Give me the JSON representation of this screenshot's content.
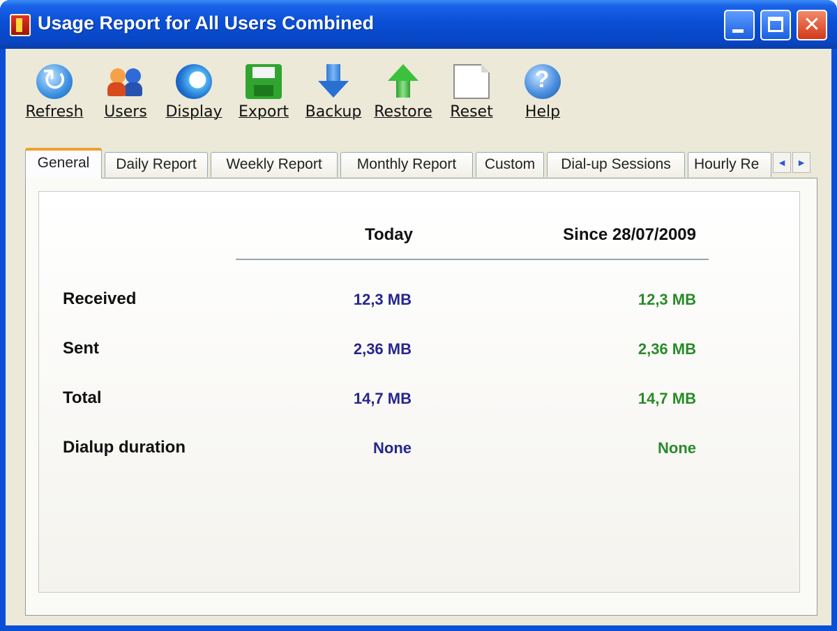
{
  "window": {
    "title": "Usage Report for All Users Combined",
    "controls": {
      "minimize_icon": "minimize-icon",
      "maximize_icon": "maximize-icon",
      "close_glyph": "✕"
    }
  },
  "toolbar": {
    "items": [
      {
        "label": "Refresh",
        "icon": "refresh-icon"
      },
      {
        "label": "Users",
        "icon": "users-icon"
      },
      {
        "label": "Display",
        "icon": "display-icon"
      },
      {
        "label": "Export",
        "icon": "save-icon"
      },
      {
        "label": "Backup",
        "icon": "arrow-down-icon"
      },
      {
        "label": "Restore",
        "icon": "arrow-up-icon"
      },
      {
        "label": "Reset",
        "icon": "blank-page-icon"
      },
      {
        "label": "Help",
        "icon": "help-icon"
      }
    ]
  },
  "tabs": {
    "items": [
      {
        "label": "General",
        "active": true
      },
      {
        "label": "Daily Report"
      },
      {
        "label": "Weekly Report"
      },
      {
        "label": "Monthly Report"
      },
      {
        "label": "Custom"
      },
      {
        "label": "Dial-up Sessions"
      },
      {
        "label": "Hourly Re"
      }
    ],
    "scroll_left": "◄",
    "scroll_right": "►"
  },
  "general": {
    "headers": {
      "today": "Today",
      "since": "Since 28/07/2009"
    },
    "rows": [
      {
        "label": "Received",
        "today": "12,3 MB",
        "since": "12,3 MB"
      },
      {
        "label": "Sent",
        "today": "2,36 MB",
        "since": "2,36 MB"
      },
      {
        "label": "Total",
        "today": "14,7 MB",
        "since": "14,7 MB"
      },
      {
        "label": "Dialup duration",
        "today": "None",
        "since": "None"
      }
    ]
  },
  "colors": {
    "title_bar": "#0a4fd6",
    "today_value": "#26268e",
    "since_value": "#2a8a2a",
    "active_tab_accent": "#f0a030"
  }
}
